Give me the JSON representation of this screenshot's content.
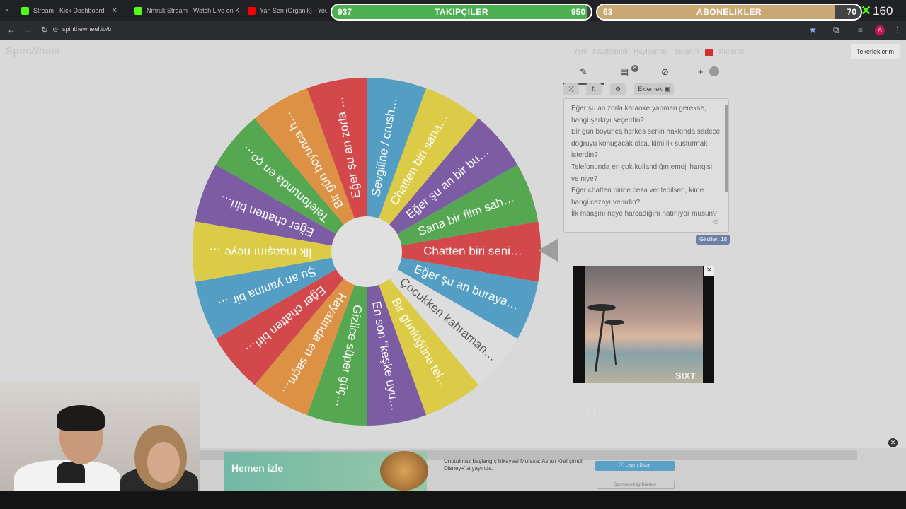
{
  "browser": {
    "tabs": [
      {
        "title": "Stream - Kick Dashboard",
        "favicon_color": "#53fc18"
      },
      {
        "title": "Nmruk Stream - Watch Live on Kick",
        "favicon_color": "#53fc18"
      },
      {
        "title": "Yan Sen (Organik) - YouTube",
        "favicon_color": "#ff0000"
      }
    ],
    "url": "spinthewheel.io/tr"
  },
  "overlay": {
    "followers": {
      "label": "TAKIPÇILER",
      "current": "937",
      "goal": "950",
      "progress": 0.986,
      "color": "#4caf50"
    },
    "subscribers": {
      "label": "ABONELIKLER",
      "current": "63",
      "goal": "70",
      "progress": 0.9,
      "color": "#c9a873"
    },
    "viewers": "160"
  },
  "site": {
    "logo": "SpinWheel",
    "nav": [
      "Yeni",
      "Kaydetmek",
      "Paylaşmak",
      "Tasarım",
      "Kullanıcı"
    ],
    "my_wheels": "Tekerleklerim"
  },
  "wheel": {
    "segments": [
      {
        "label": "Chatten biri seni…",
        "color": "#cc2f33"
      },
      {
        "label": "Eğer şu an buraya…",
        "color": "#3d91bc"
      },
      {
        "label": "Çocukken kahraman…",
        "color": "#d9d9d9"
      },
      {
        "label": "Bir günlüğüne tel…",
        "color": "#d8c42e"
      },
      {
        "label": "En son \"keşke uyu…",
        "color": "#6a4697"
      },
      {
        "label": "Gizlice süper güç…",
        "color": "#3e9b3a"
      },
      {
        "label": "Hayatında en saçm…",
        "color": "#d9822c"
      },
      {
        "label": "Eğer chatten biri…",
        "color": "#cc2f33"
      },
      {
        "label": "Şu an yanına bir …",
        "color": "#3d91bc"
      },
      {
        "label": "İlk maaşını neye …",
        "color": "#d8c42e"
      },
      {
        "label": "Eğer chatten biri…",
        "color": "#6a4697"
      },
      {
        "label": "Telefonunda en ço…",
        "color": "#3e9b3a"
      },
      {
        "label": "Bir gün boyunca h…",
        "color": "#d9822c"
      },
      {
        "label": "Eğer şu an zorla …",
        "color": "#cc2f33"
      },
      {
        "label": "Sevgiline / crush…",
        "color": "#3d91bc"
      },
      {
        "label": "Chatten biri sana…",
        "color": "#d8c42e"
      },
      {
        "label": "Eğer şu an bir bu…",
        "color": "#6a4697"
      },
      {
        "label": "Sana bir film sah…",
        "color": "#3e9b3a"
      }
    ]
  },
  "panel": {
    "add_label": "Eklemek",
    "entries": [
      "Eğer şu an zorla karaoke yapman gerekse, hangi şarkıyı seçerdin?",
      "Bir gün boyunca herkes senin hakkında sadece doğruyu konuşacak olsa, kimi ilk susturmak isterdin?",
      "Telefonunda en çok kullandığın emoji hangisi ve niye?",
      "Eğer chatten birine ceza verilebilsen, kime hangi cezayı verirdin?",
      "İlk maaşını neye harcadığını hatırlıyor musun?"
    ],
    "entry_count": "Girdiler: 18",
    "badge_count": "8"
  },
  "ad": {
    "brand": "SIXT",
    "banner_cta": "Hemen izle",
    "banner_text": "Unutulmaz başlangıç hikayesi Mufasa: Aslan Kral şimdi Disney+'ta yayında.",
    "learn_more": "Learn More",
    "sponsored": "Sponsored by Disney+"
  }
}
